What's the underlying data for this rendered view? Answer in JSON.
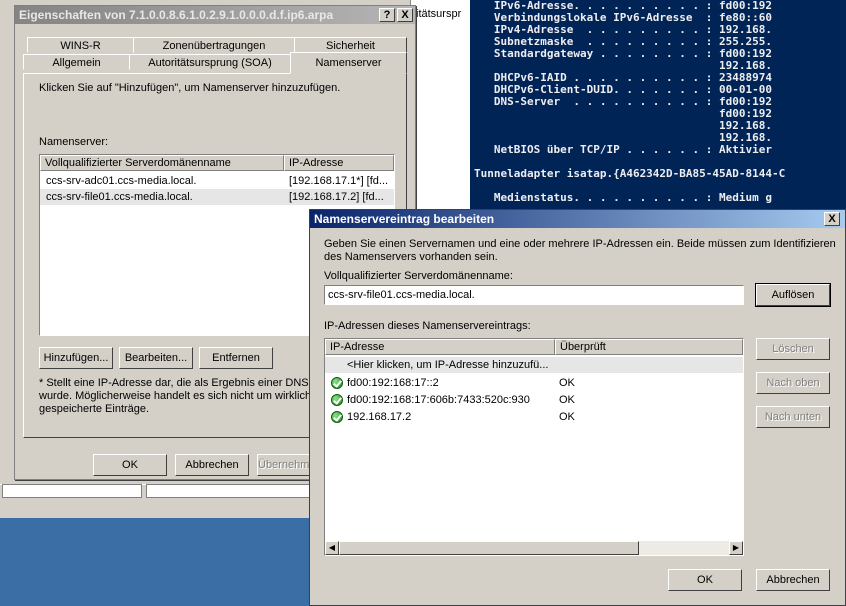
{
  "background": {
    "window_partial_text": "itätsurspr"
  },
  "console": {
    "lines": [
      "   IPv6-Adresse. . . . . . . . . . : fd00:192",
      "   Verbindungslokale IPv6-Adresse  : fe80::60",
      "   IPv4-Adresse  . . . . . . . . . : 192.168.",
      "   Subnetzmaske  . . . . . . . . . : 255.255.",
      "   Standardgateway . . . . . . . . : fd00:192",
      "                                     192.168.",
      "   DHCPv6-IAID . . . . . . . . . . : 23488974",
      "   DHCPv6-Client-DUID. . . . . . . : 00-01-00",
      "   DNS-Server  . . . . . . . . . . : fd00:192",
      "                                     fd00:192",
      "                                     192.168.",
      "                                     192.168.",
      "   NetBIOS über TCP/IP . . . . . . : Aktivier",
      "",
      "Tunneladapter isatap.{A462342D-BA85-45AD-8144-C",
      "",
      "   Medienstatus. . . . . . . . . . : Medium g"
    ]
  },
  "props_dialog": {
    "title": "Eigenschaften von 7.1.0.0.8.6.1.0.2.9.1.0.0.0.d.f.ip6.arpa",
    "help_label": "?",
    "close_label": "X",
    "tabs_row1": [
      "WINS-R",
      "Zonenübertragungen",
      "Sicherheit"
    ],
    "tabs_row2": [
      "Allgemein",
      "Autoritätsursprung (SOA)",
      "Namenserver"
    ],
    "instruction": "Klicken Sie auf \"Hinzufügen\", um Namenserver hinzuzufügen.",
    "list_label": "Namenserver:",
    "columns": [
      "Vollqualifizierter Serverdomänenname",
      "IP-Adresse"
    ],
    "rows": [
      {
        "name": "ccs-srv-adc01.ccs-media.local.",
        "ip": "[192.168.17.1*] [fd..."
      },
      {
        "name": "ccs-srv-file01.ccs-media.local.",
        "ip": "[192.168.17.2] [fd..."
      }
    ],
    "buttons": {
      "add": "Hinzufügen...",
      "edit": "Bearbeiten...",
      "remove": "Entfernen"
    },
    "note_lines": [
      "* Stellt eine IP-Adresse dar, die als Ergebnis einer DNS-Ab",
      "wurde. Möglicherweise handelt es sich nicht um wirkliche",
      "gespeicherte Einträge."
    ],
    "footer": {
      "ok": "OK",
      "cancel": "Abbrechen",
      "apply": "Übernehmen"
    }
  },
  "edit_dialog": {
    "title": "Namenservereintrag bearbeiten",
    "close_label": "X",
    "intro_lines": [
      "Geben Sie einen Servernamen und eine oder mehrere IP-Adressen ein. Beide müssen zum Identifizieren",
      "des Namenservers vorhanden sein."
    ],
    "fqdn_label": "Vollqualifizierter Serverdomänenname:",
    "fqdn_value": "ccs-srv-file01.ccs-media.local.",
    "resolve_button": "Auflösen",
    "ip_list_label": "IP-Adressen dieses Namenservereintrags:",
    "columns": [
      "IP-Adresse",
      "Überprüft"
    ],
    "add_row_placeholder": "<Hier klicken, um IP-Adresse hinzuzufü...",
    "rows": [
      {
        "ip": "fd00:192:168:17::2",
        "status": "OK"
      },
      {
        "ip": "fd00:192:168:17:606b:7433:520c:930",
        "status": "OK"
      },
      {
        "ip": "192.168.17.2",
        "status": "OK"
      }
    ],
    "side_buttons": {
      "delete": "Löschen",
      "move_up": "Nach oben",
      "move_down": "Nach unten"
    },
    "footer": {
      "ok": "OK",
      "cancel": "Abbrechen"
    }
  }
}
